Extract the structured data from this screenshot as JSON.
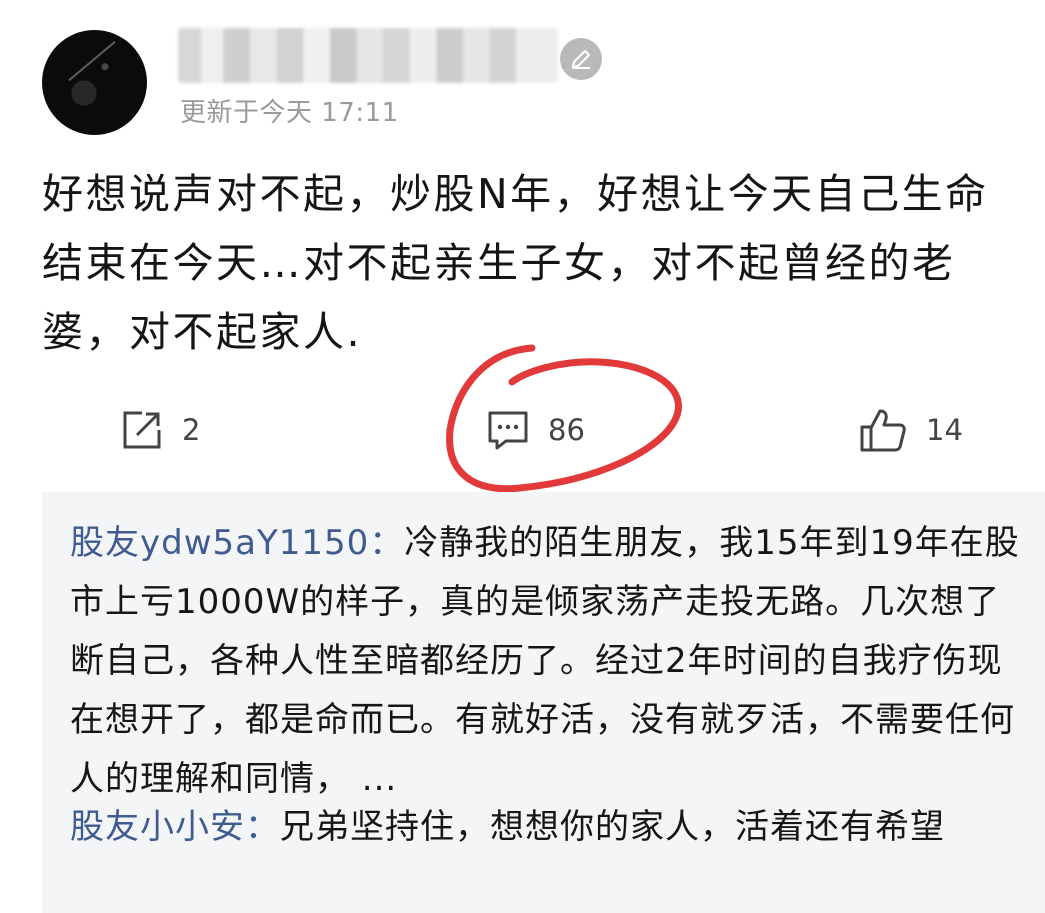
{
  "post": {
    "timestamp": "更新于今天 17:11",
    "text": "好想说声对不起，炒股N年，好想让今天自己生命结束在今天…对不起亲生子女，对不起曾经的老婆，对不起家人."
  },
  "actions": {
    "share_count": "2",
    "comment_count": "86",
    "like_count": "14"
  },
  "comments": [
    {
      "author": "股友ydw5aY1150",
      "separator": "：",
      "text": "冷静我的陌生朋友，我15年到19年在股市上亏1000W的样子，真的是倾家荡产走投无路。几次想了断自己，各种人性至暗都经历了。经过2年时间的自我疗伤现在想开了，都是命而已。有就好活，没有就歹活，不需要任何人的理解和同情，  ..."
    },
    {
      "author": "股友小小安",
      "separator": "：",
      "text": "兄弟坚持住，想想你的家人，活着还有希望"
    }
  ],
  "icons": {
    "share": "share-icon",
    "comment": "comment-icon",
    "like": "thumbs-up-icon",
    "edit": "edit-icon"
  },
  "colors": {
    "author_link": "#3f5b92",
    "highlight_circle": "#e23a3a",
    "comment_bg": "#f4f5f6",
    "timestamp": "#9a9a9a"
  }
}
